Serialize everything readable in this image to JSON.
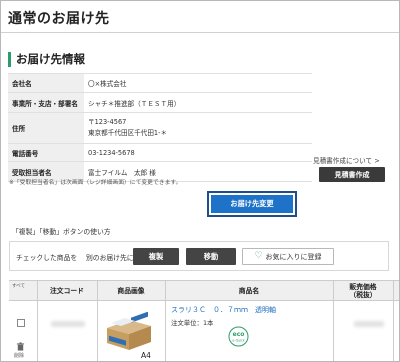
{
  "page": {
    "title": "通常のお届け先"
  },
  "delivery_section": {
    "title": "お届け先情報",
    "rows": [
      {
        "label": "会社名",
        "value": "〇×株式会社"
      },
      {
        "label": "事業所・支店・部署名",
        "value": "シャチ＊推進部（ＴＥＳＴ用）"
      },
      {
        "label": "住所",
        "postal": "〒123-4567",
        "address": "東京都千代田区千代田1-＊"
      },
      {
        "label": "電話番号",
        "value": "03-1234-5678"
      },
      {
        "label": "受取担当者名",
        "value": "富士フイルム　太郎 様"
      }
    ],
    "note": "※「受取担当者名」は次画面（レジ詳細画面）にて変更できます。"
  },
  "estimate": {
    "link_text": "見積書作成について",
    "link_arrow": ">",
    "button_label": "見積書作成"
  },
  "change_address_button": "お届け先変更",
  "help_text": "「複製」「移動」ボタンの使い方",
  "action_bar": {
    "label_checked": "チェックした商品を",
    "label_target": "別のお届け先に",
    "copy_button": "複製",
    "move_button": "移動",
    "favorite_button": "お気に入りに登録"
  },
  "table": {
    "select_all_label": "すべて",
    "headers": {
      "order_code": "注文コード",
      "product_image": "商品画像",
      "product_name": "商品名",
      "price_line1": "販売価格",
      "price_line2": "（税抜）"
    },
    "rows": [
      {
        "name": "スラリ３Ｃ　０．７ｍｍ　透明軸",
        "unit": "注文単位：1本",
        "image_label": "A4",
        "delete_label": "削除",
        "badge_top": "eco",
        "badge_bottom": "e-Quick"
      }
    ]
  },
  "colors": {
    "accent_green": "#2a9d6a",
    "primary_blue": "#1e73c8",
    "dark_button": "#444444",
    "link_blue": "#1e6fbf"
  }
}
